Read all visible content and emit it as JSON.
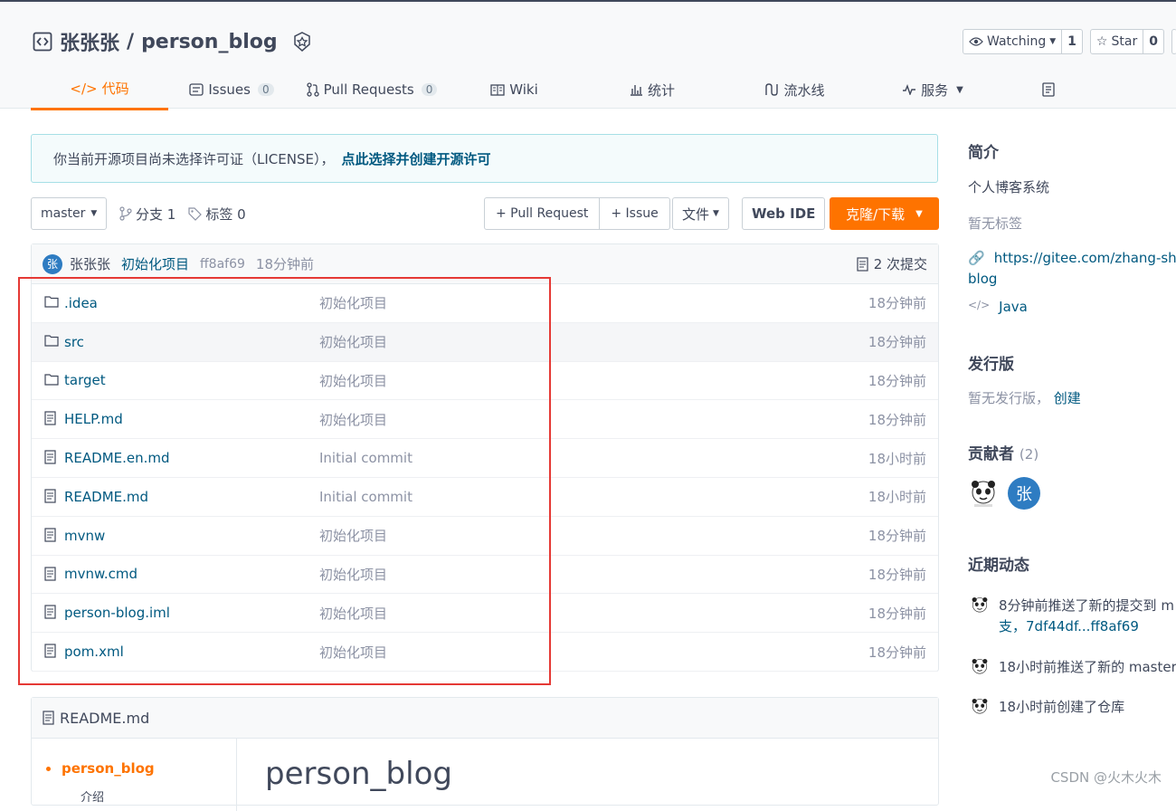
{
  "repo": {
    "owner": "张张张",
    "separator": "/",
    "name": "person_blog"
  },
  "actions": {
    "watch_label": "Watching",
    "watch_count": "1",
    "star_label": "Star",
    "star_count": "0"
  },
  "tabs": [
    {
      "label": "代码"
    },
    {
      "label": "Issues",
      "count": "0"
    },
    {
      "label": "Pull Requests",
      "count": "0"
    },
    {
      "label": "Wiki"
    },
    {
      "label": "统计"
    },
    {
      "label": "流水线"
    },
    {
      "label": "服务"
    }
  ],
  "notice": {
    "text": "你当前开源项目尚未选择许可证（LICENSE），",
    "link": "点此选择并创建开源许可"
  },
  "toolbar": {
    "branch": "master",
    "branches": "分支 1",
    "tags": "标签 0",
    "pull_request": "+ Pull Request",
    "issue": "+ Issue",
    "file": "文件",
    "web_ide": "Web IDE",
    "clone": "克隆/下载"
  },
  "commit": {
    "avatar": "张",
    "author": "张张张",
    "message": "初始化项目",
    "hash": "ff8af69",
    "time": "18分钟前",
    "count": "2 次提交"
  },
  "files": [
    {
      "type": "folder",
      "name": ".idea",
      "message": "初始化项目",
      "time": "18分钟前"
    },
    {
      "type": "folder",
      "name": "src",
      "message": "初始化项目",
      "time": "18分钟前"
    },
    {
      "type": "folder",
      "name": "target",
      "message": "初始化项目",
      "time": "18分钟前"
    },
    {
      "type": "file",
      "name": "HELP.md",
      "message": "初始化项目",
      "time": "18分钟前"
    },
    {
      "type": "file",
      "name": "README.en.md",
      "message": "Initial commit",
      "time": "18小时前"
    },
    {
      "type": "file",
      "name": "README.md",
      "message": "Initial commit",
      "time": "18小时前"
    },
    {
      "type": "file",
      "name": "mvnw",
      "message": "初始化项目",
      "time": "18分钟前"
    },
    {
      "type": "file",
      "name": "mvnw.cmd",
      "message": "初始化项目",
      "time": "18分钟前"
    },
    {
      "type": "file",
      "name": "person-blog.iml",
      "message": "初始化项目",
      "time": "18分钟前"
    },
    {
      "type": "file",
      "name": "pom.xml",
      "message": "初始化项目",
      "time": "18分钟前"
    }
  ],
  "readme": {
    "filename": "README.md",
    "toc_item": "person_blog",
    "toc_sub": "介绍",
    "title": "person_blog"
  },
  "sidebar": {
    "intro_title": "简介",
    "intro_desc": "个人博客系统",
    "no_tags": "暂无标签",
    "url_line1": "https://gitee.com/zhang-shou",
    "url_line2": "blog",
    "language": "Java",
    "release_title": "发行版",
    "no_release": "暂无发行版，",
    "create": "创建",
    "contributors_title": "贡献者",
    "contributors_count": "(2)",
    "contributor_avatar": "张",
    "activity_title": "近期动态",
    "activities": [
      {
        "line1": "8分钟前推送了新的提交到 m",
        "line2": "支，7df44df...ff8af69"
      },
      {
        "line1": "18小时前推送了新的 master"
      },
      {
        "line1": "18小时前创建了仓库"
      }
    ]
  },
  "watermark": "CSDN @火木火木"
}
